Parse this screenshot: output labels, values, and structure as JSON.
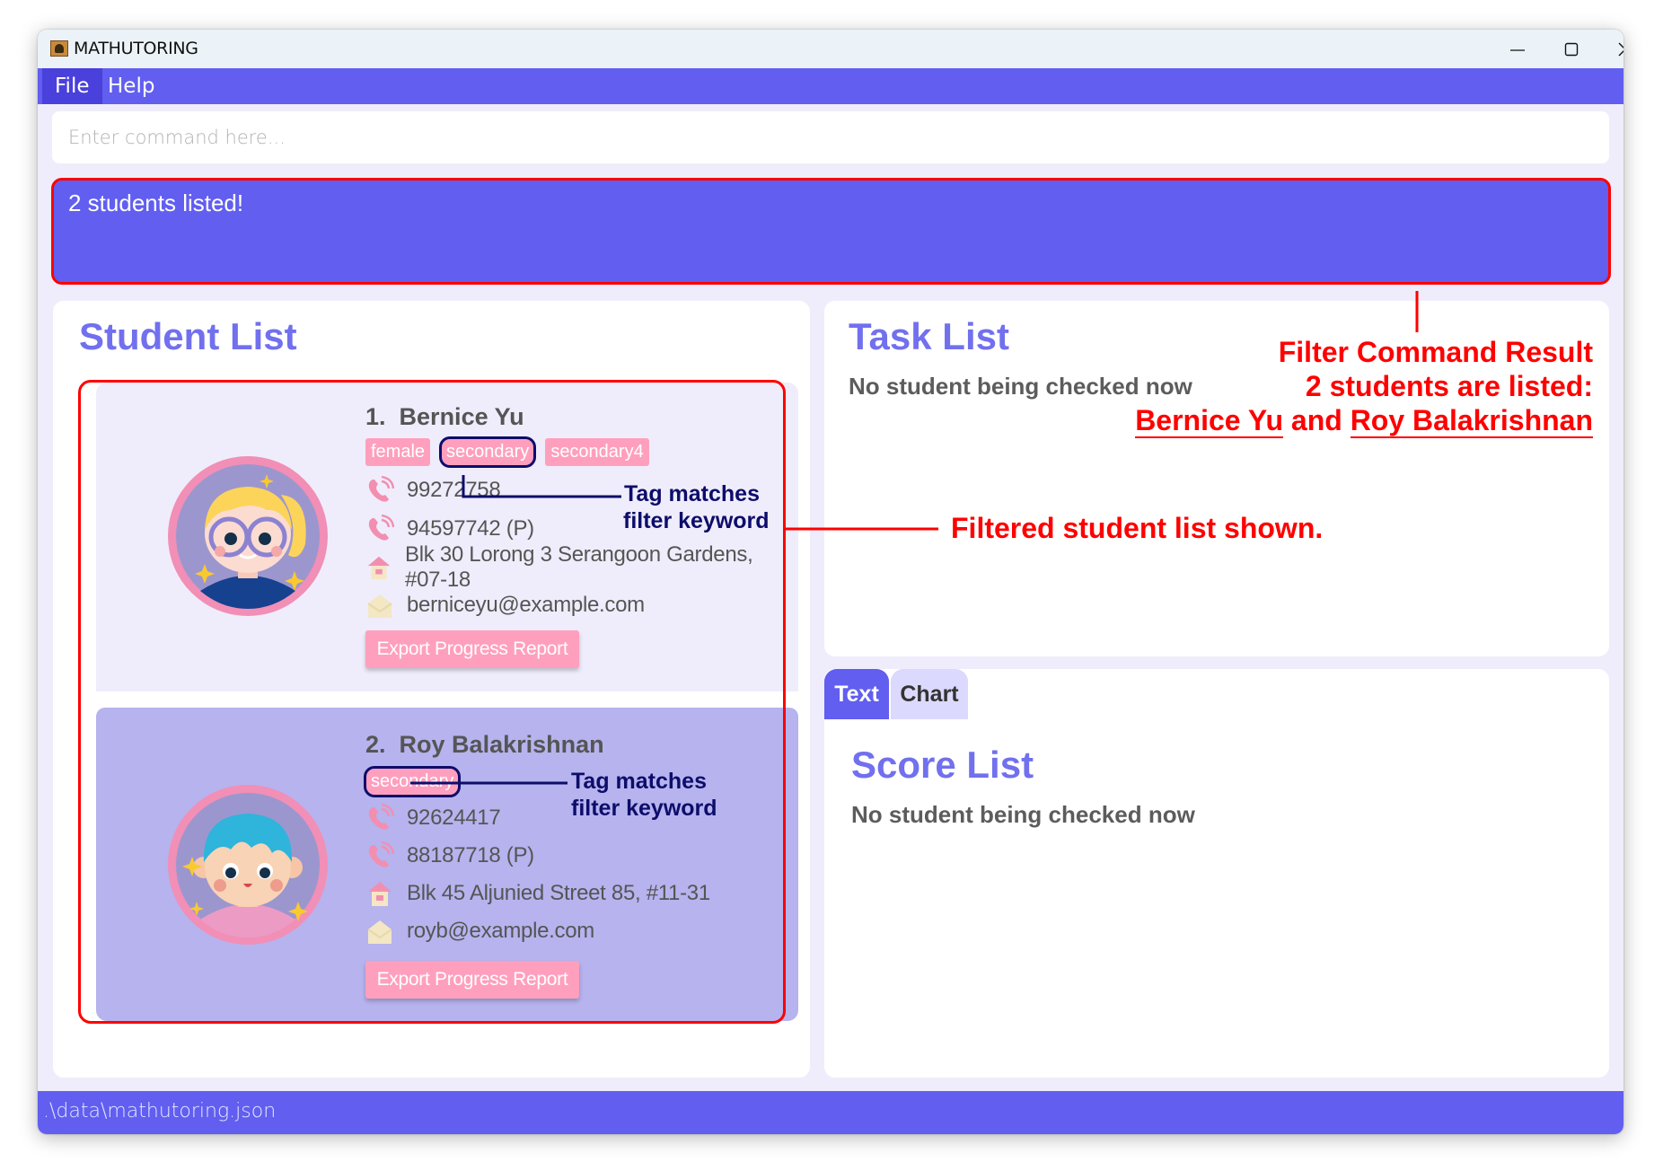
{
  "window": {
    "title": "MATHUTORING",
    "controls": [
      "minimize",
      "maximize",
      "close"
    ]
  },
  "menu": {
    "items": [
      {
        "label": "File",
        "active": true
      },
      {
        "label": "Help",
        "active": false
      }
    ]
  },
  "command": {
    "placeholder": "Enter command here...",
    "value": ""
  },
  "result": {
    "message": "2 students listed!"
  },
  "student_list": {
    "title": "Student List",
    "students": [
      {
        "index": "1.",
        "name": "Bernice Yu",
        "tags": [
          "female",
          "secondary",
          "secondary4"
        ],
        "highlighted_tag": "secondary",
        "phone": "99272758",
        "parent_phone": "94597742 (P)",
        "address": "Blk 30 Lorong 3 Serangoon Gardens, #07-18",
        "email": "berniceyu@example.com",
        "export_label": "Export Progress Report"
      },
      {
        "index": "2.",
        "name": "Roy Balakrishnan",
        "tags": [
          "secondary"
        ],
        "highlighted_tag": "secondary",
        "phone": "92624417",
        "parent_phone": "88187718 (P)",
        "address": "Blk 45 Aljunied Street 85, #11-31",
        "email": "royb@example.com",
        "export_label": "Export Progress Report"
      }
    ]
  },
  "task_list": {
    "title": "Task List",
    "empty_text": "No student being checked now"
  },
  "score_panel": {
    "tabs": [
      {
        "label": "Text",
        "active": true
      },
      {
        "label": "Chart",
        "active": false
      }
    ],
    "title": "Score List",
    "empty_text": "No student being checked now"
  },
  "status_bar": {
    "path": ".\\data\\mathutoring.json"
  },
  "annotations": {
    "tag_match_1": [
      "Tag matches",
      "filter keyword"
    ],
    "tag_match_2": [
      "Tag matches",
      "filter keyword"
    ],
    "filtered_list": "Filtered student list shown.",
    "filter_result": {
      "line1": "Filter Command Result",
      "line2": "2 students are listed:",
      "name1": "Bernice Yu",
      "joiner": "and",
      "name2": "Roy Balakrishnan"
    }
  },
  "colors": {
    "primary": "#615ef0",
    "background": "#efedfb",
    "title_purple": "#7170ee",
    "tag_pink": "#ff9fbe",
    "card_selected": "#b6b3ee",
    "annotation_red": "#ff0000",
    "annotation_navy": "#0d0d6b"
  }
}
